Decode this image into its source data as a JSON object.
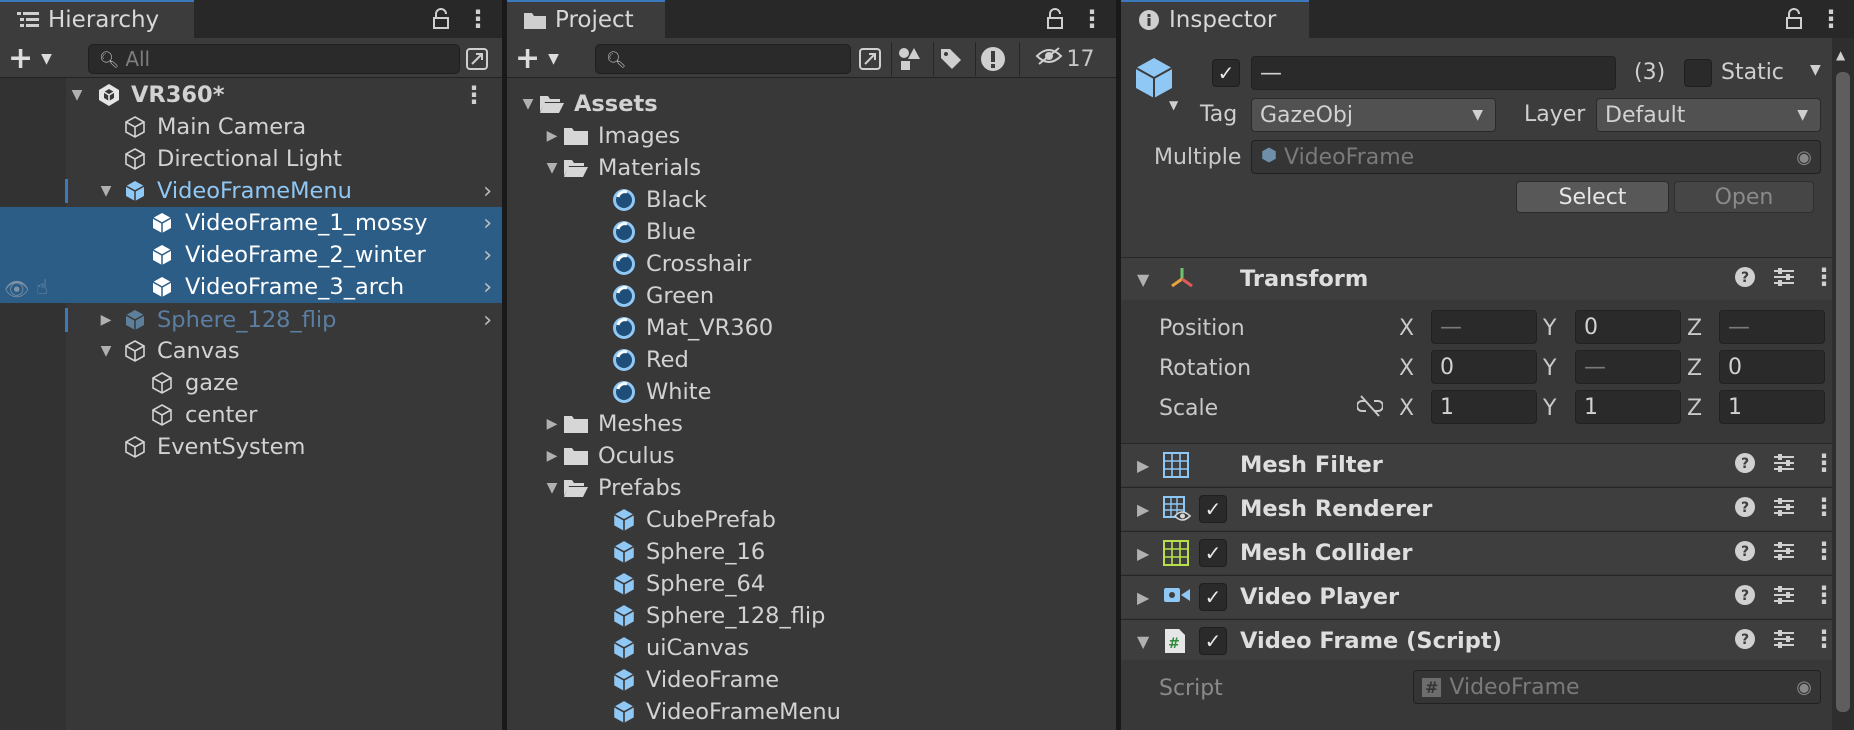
{
  "hierarchy": {
    "tab_label": "Hierarchy",
    "search_placeholder": "All",
    "scene": "VR360*",
    "items": [
      {
        "label": "Main Camera"
      },
      {
        "label": "Directional Light"
      },
      {
        "label": "VideoFrameMenu"
      },
      {
        "label": "VideoFrame_1_mossy"
      },
      {
        "label": "VideoFrame_2_winter"
      },
      {
        "label": "VideoFrame_3_arch"
      },
      {
        "label": "Sphere_128_flip"
      },
      {
        "label": "Canvas"
      },
      {
        "label": "gaze"
      },
      {
        "label": "center"
      },
      {
        "label": "EventSystem"
      }
    ]
  },
  "project": {
    "tab_label": "Project",
    "search_value": "",
    "hidden_count": "17",
    "tree": [
      {
        "label": "Assets"
      },
      {
        "label": "Images"
      },
      {
        "label": "Materials"
      },
      {
        "label": "Black"
      },
      {
        "label": "Blue"
      },
      {
        "label": "Crosshair"
      },
      {
        "label": "Green"
      },
      {
        "label": "Mat_VR360"
      },
      {
        "label": "Red"
      },
      {
        "label": "White"
      },
      {
        "label": "Meshes"
      },
      {
        "label": "Oculus"
      },
      {
        "label": "Prefabs"
      },
      {
        "label": "CubePrefab"
      },
      {
        "label": "Sphere_16"
      },
      {
        "label": "Sphere_64"
      },
      {
        "label": "Sphere_128_flip"
      },
      {
        "label": "uiCanvas"
      },
      {
        "label": "VideoFrame"
      },
      {
        "label": "VideoFrameMenu"
      }
    ]
  },
  "inspector": {
    "tab_label": "Inspector",
    "name_value": "—",
    "count": "(3)",
    "static_label": "Static",
    "tag_label": "Tag",
    "tag_value": "GazeObj",
    "layer_label": "Layer",
    "layer_value": "Default",
    "multiple_label": "Multiple",
    "multiple_value": "VideoFrame",
    "select_label": "Select",
    "open_label": "Open",
    "transform": {
      "name": "Transform",
      "position_label": "Position",
      "rotation_label": "Rotation",
      "scale_label": "Scale",
      "x": "X",
      "y": "Y",
      "z": "Z",
      "position": [
        "—",
        "0",
        "—"
      ],
      "rotation": [
        "0",
        "—",
        "0"
      ],
      "scale": [
        "1",
        "1",
        "1"
      ]
    },
    "components": [
      {
        "name": "Mesh Filter"
      },
      {
        "name": "Mesh Renderer"
      },
      {
        "name": "Mesh Collider"
      },
      {
        "name": "Video Player"
      },
      {
        "name": "Video Frame (Script)"
      }
    ],
    "script_label": "Script",
    "script_value": "VideoFrame"
  },
  "colors": {
    "accent": "#3a79bb",
    "selection": "#2c5d87",
    "prefab": "#8fc7f5",
    "panel": "#383838"
  }
}
